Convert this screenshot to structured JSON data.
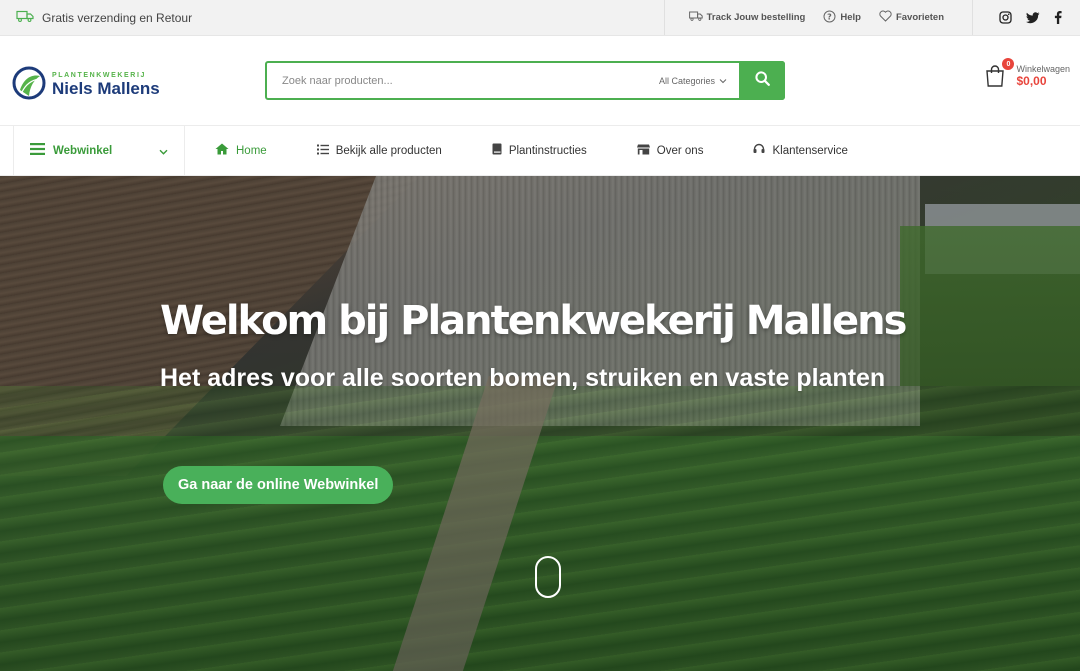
{
  "topbar": {
    "shipping_text": "Gratis verzending en Retour",
    "links": {
      "track": "Track Jouw bestelling",
      "help": "Help",
      "favorites": "Favorieten"
    }
  },
  "header": {
    "logo_sub": "PLANTENKWEKERIJ",
    "logo_main": "Niels Mallens",
    "search_placeholder": "Zoek naar producten...",
    "search_category": "All Categories",
    "cart_count": "0",
    "cart_label": "Winkelwagen",
    "cart_total": "$0,00"
  },
  "nav": {
    "category_label": "Webwinkel",
    "items": [
      {
        "label": "Home",
        "icon": "home-icon"
      },
      {
        "label": "Bekijk alle producten",
        "icon": "list-icon"
      },
      {
        "label": "Plantinstructies",
        "icon": "book-icon"
      },
      {
        "label": "Over ons",
        "icon": "store-icon"
      },
      {
        "label": "Klantenservice",
        "icon": "headset-icon"
      }
    ]
  },
  "hero": {
    "title": "Welkom bij Plantenkwekerij Mallens",
    "subtitle": "Het adres voor alle soorten bomen, struiken en vaste planten",
    "button": "Ga naar de online Webwinkel"
  },
  "colors": {
    "accent": "#4caf50",
    "brand_blue": "#1d3b7a",
    "cart_red": "#e8453c"
  }
}
